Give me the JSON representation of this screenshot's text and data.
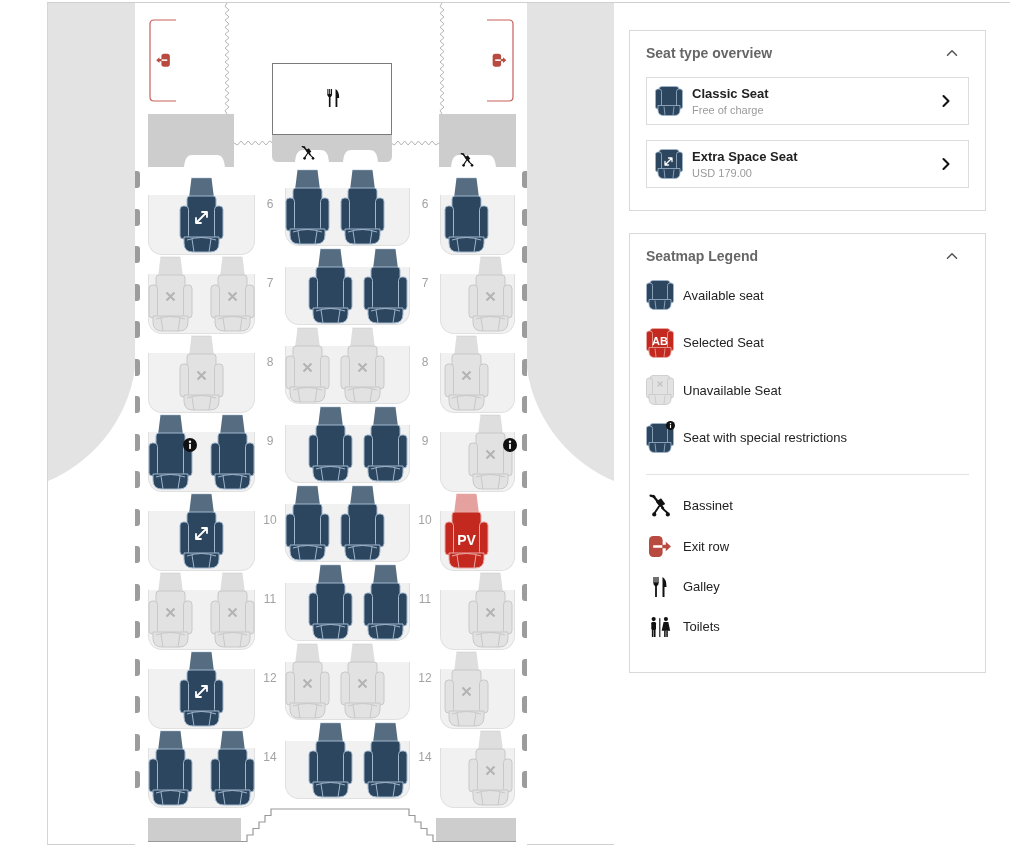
{
  "seat_map": {
    "rows": [
      {
        "row_labels": [
          "6",
          "6"
        ],
        "blocks": [
          {
            "seats": [
              {
                "kind": "extra_space",
                "available": true,
                "selected": false,
                "restricted": false
              }
            ]
          },
          {
            "seats": [
              {
                "kind": "classic",
                "available": true,
                "selected": false,
                "restricted": false
              },
              {
                "kind": "classic",
                "available": true,
                "selected": false,
                "restricted": false
              }
            ]
          },
          {
            "seats": [
              {
                "kind": "classic",
                "available": true,
                "selected": false,
                "restricted": false
              }
            ]
          }
        ]
      },
      {
        "row_labels": [
          "7",
          "7"
        ],
        "blocks": [
          {
            "seats": [
              {
                "available": false,
                "selected": false,
                "restricted": false
              },
              {
                "available": false,
                "selected": false,
                "restricted": false
              }
            ]
          },
          {
            "seats": [
              {
                "kind": "classic",
                "available": true,
                "selected": false,
                "restricted": false
              },
              {
                "kind": "classic",
                "available": true,
                "selected": false,
                "restricted": false
              }
            ]
          },
          {
            "seats": [
              {
                "available": false,
                "selected": false,
                "restricted": false
              }
            ]
          }
        ]
      },
      {
        "row_labels": [
          "8",
          "8"
        ],
        "blocks": [
          {
            "seats": [
              {
                "available": false,
                "selected": false,
                "restricted": false
              }
            ]
          },
          {
            "seats": [
              {
                "available": false,
                "selected": false,
                "restricted": false
              },
              {
                "available": false,
                "selected": false,
                "restricted": false
              }
            ]
          },
          {
            "seats": [
              {
                "available": false,
                "selected": false,
                "restricted": false
              }
            ]
          }
        ]
      },
      {
        "row_labels": [
          "9",
          "9"
        ],
        "blocks": [
          {
            "seats": [
              {
                "kind": "classic",
                "available": true,
                "selected": false,
                "restricted": true
              },
              {
                "kind": "classic",
                "available": true,
                "selected": false,
                "restricted": false
              }
            ]
          },
          {
            "seats": [
              {
                "kind": "classic",
                "available": true,
                "selected": false,
                "restricted": false
              },
              {
                "kind": "classic",
                "available": true,
                "selected": false,
                "restricted": false
              }
            ]
          },
          {
            "seats": [
              {
                "available": false,
                "selected": false,
                "restricted": true
              }
            ]
          }
        ]
      },
      {
        "row_labels": [
          "10",
          "10"
        ],
        "blocks": [
          {
            "seats": [
              {
                "kind": "extra_space",
                "available": true,
                "selected": false,
                "restricted": false
              }
            ]
          },
          {
            "seats": [
              {
                "kind": "classic",
                "available": true,
                "selected": false,
                "restricted": false
              },
              {
                "kind": "classic",
                "available": true,
                "selected": false,
                "restricted": false
              }
            ]
          },
          {
            "seats": [
              {
                "kind": "classic",
                "available": true,
                "selected": true,
                "restricted": false,
                "label": "PV"
              }
            ]
          }
        ]
      },
      {
        "row_labels": [
          "11",
          "11"
        ],
        "blocks": [
          {
            "seats": [
              {
                "available": false,
                "selected": false,
                "restricted": false
              },
              {
                "available": false,
                "selected": false,
                "restricted": false
              }
            ]
          },
          {
            "seats": [
              {
                "kind": "classic",
                "available": true,
                "selected": false,
                "restricted": false
              },
              {
                "kind": "classic",
                "available": true,
                "selected": false,
                "restricted": false
              }
            ]
          },
          {
            "seats": [
              {
                "available": false,
                "selected": false,
                "restricted": false
              }
            ]
          }
        ]
      },
      {
        "row_labels": [
          "12",
          "12"
        ],
        "blocks": [
          {
            "seats": [
              {
                "kind": "extra_space",
                "available": true,
                "selected": false,
                "restricted": false
              }
            ]
          },
          {
            "seats": [
              {
                "available": false,
                "selected": false,
                "restricted": false
              },
              {
                "available": false,
                "selected": false,
                "restricted": false
              }
            ]
          },
          {
            "seats": [
              {
                "available": false,
                "selected": false,
                "restricted": false
              }
            ]
          }
        ]
      },
      {
        "row_labels": [
          "14",
          "14"
        ],
        "blocks": [
          {
            "seats": [
              {
                "kind": "classic",
                "available": true,
                "selected": false,
                "restricted": false
              },
              {
                "kind": "classic",
                "available": true,
                "selected": false,
                "restricted": false
              }
            ]
          },
          {
            "seats": [
              {
                "kind": "classic",
                "available": true,
                "selected": false,
                "restricted": false
              },
              {
                "kind": "classic",
                "available": true,
                "selected": false,
                "restricted": false
              }
            ]
          },
          {
            "seats": [
              {
                "available": false,
                "selected": false,
                "restricted": false
              }
            ]
          }
        ]
      }
    ]
  },
  "seat_type_overview": {
    "title": "Seat type overview",
    "expanded": true,
    "items": [
      {
        "kind": "classic",
        "title": "Classic Seat",
        "price": "Free of charge"
      },
      {
        "kind": "extra_space",
        "title": "Extra Space Seat",
        "price": "USD 179.00"
      }
    ]
  },
  "seatmap_legend": {
    "title": "Seatmap Legend",
    "expanded": true,
    "seat_items": [
      {
        "kind": "available",
        "label": "Available seat"
      },
      {
        "kind": "selected",
        "label": "Selected Seat",
        "badge": "AB"
      },
      {
        "kind": "unavailable",
        "label": "Unavailable Seat"
      },
      {
        "kind": "restricted",
        "label": "Seat with special restrictions"
      }
    ],
    "facility_items": [
      {
        "kind": "bassinet",
        "label": "Bassinet"
      },
      {
        "kind": "exit",
        "label": "Exit row"
      },
      {
        "kind": "galley",
        "label": "Galley"
      },
      {
        "kind": "toilets",
        "label": "Toilets"
      }
    ]
  }
}
